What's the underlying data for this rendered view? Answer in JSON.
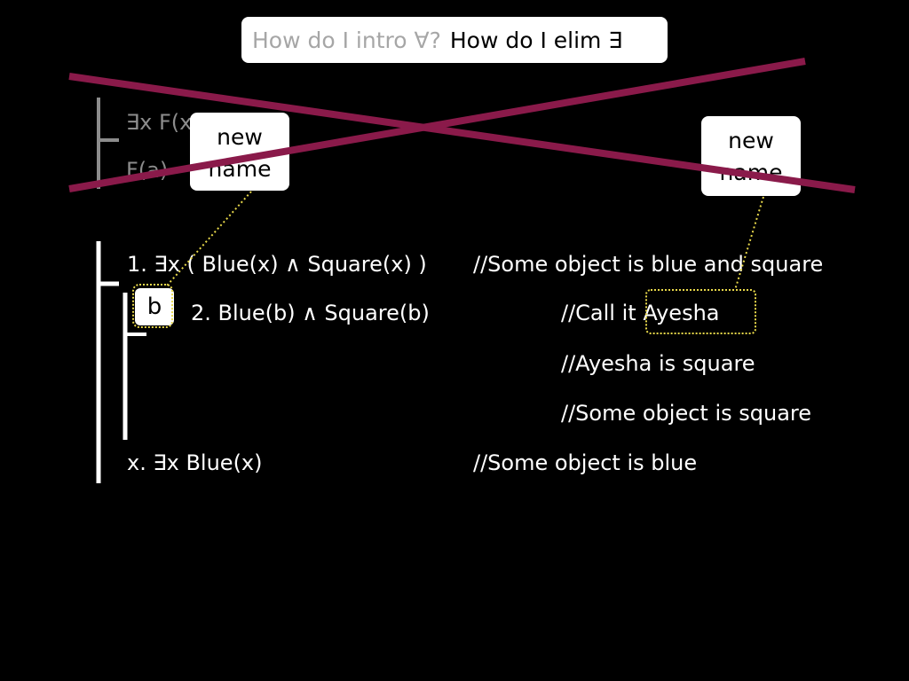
{
  "title": {
    "question_intro": "How do I intro ∀?",
    "question_elim": "How do I elim ∃"
  },
  "crossed_example": {
    "line1": "∃x F(x)",
    "line2": "F(a)"
  },
  "callouts": {
    "left": {
      "line1": "new",
      "line2": "name"
    },
    "right": {
      "line1": "new",
      "line2": "name"
    }
  },
  "proof": {
    "premise": {
      "formula": "1. ∃x ( Blue(x) ∧ Square(x) )",
      "comment": "//Some object is blue and square"
    },
    "subproof": {
      "boxed_name": "b",
      "assumption": "2. Blue(b) ∧ Square(b)",
      "assumption_comment_prefix": "//Call it ",
      "assumption_comment_name": "Ayesha",
      "comments": [
        "//Ayesha is square",
        "//Some object is square"
      ]
    },
    "conclusion": {
      "formula": "x. ∃x Blue(x)",
      "comment": "//Some object is blue"
    }
  },
  "colors": {
    "background": "#000000",
    "cross": "#8a1a4a",
    "dotted": "#e8d84a",
    "callout_bg": "#ffffff"
  }
}
